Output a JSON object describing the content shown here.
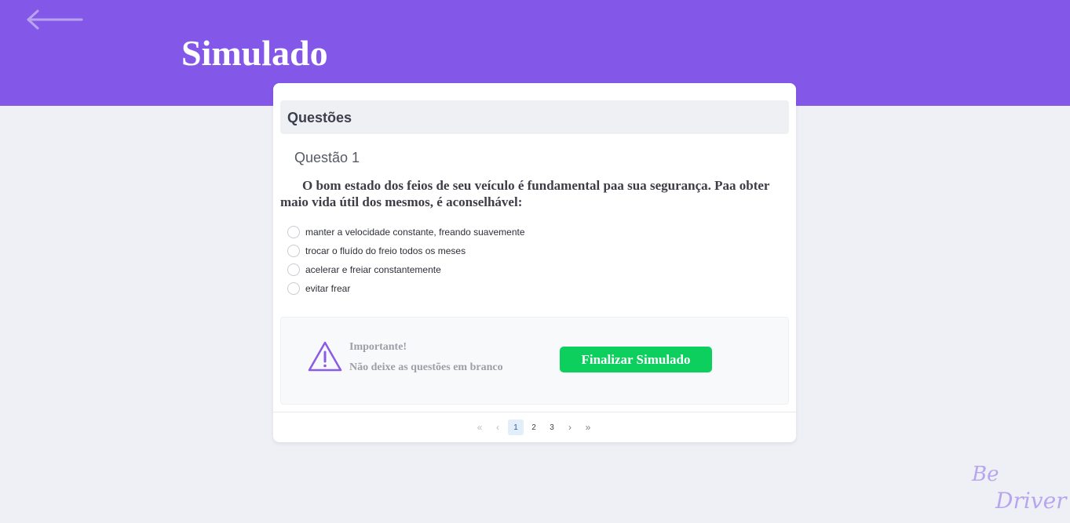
{
  "header": {
    "title": "Simulado",
    "background_color": "#8358e8",
    "back_icon": "arrow-left-icon"
  },
  "questions_card": {
    "header_label": "Questões",
    "question_number": "Questão 1",
    "question_text": "O bom estado dos feios de seu veículo é fundamental paa sua segurança. Paa obter maio vida útil dos mesmos, é aconselhável:",
    "options": [
      "manter a velocidade constante, freando suavemente",
      "trocar o fluído do freio todos os meses",
      "acelerar e freiar constantemente",
      "evitar frear"
    ]
  },
  "notice": {
    "icon": "warning-triangle-icon",
    "title": "Importante!",
    "text": "Não deixe as questões em branco"
  },
  "finish_button": {
    "label": "Finalizar Simulado",
    "color": "#0ccf5e"
  },
  "pagination": {
    "first": "«",
    "prev": "‹",
    "pages": [
      "1",
      "2",
      "3"
    ],
    "current": "1",
    "next": "›",
    "last": "»"
  },
  "brand": {
    "line1": "Be",
    "line2": "Driver"
  }
}
